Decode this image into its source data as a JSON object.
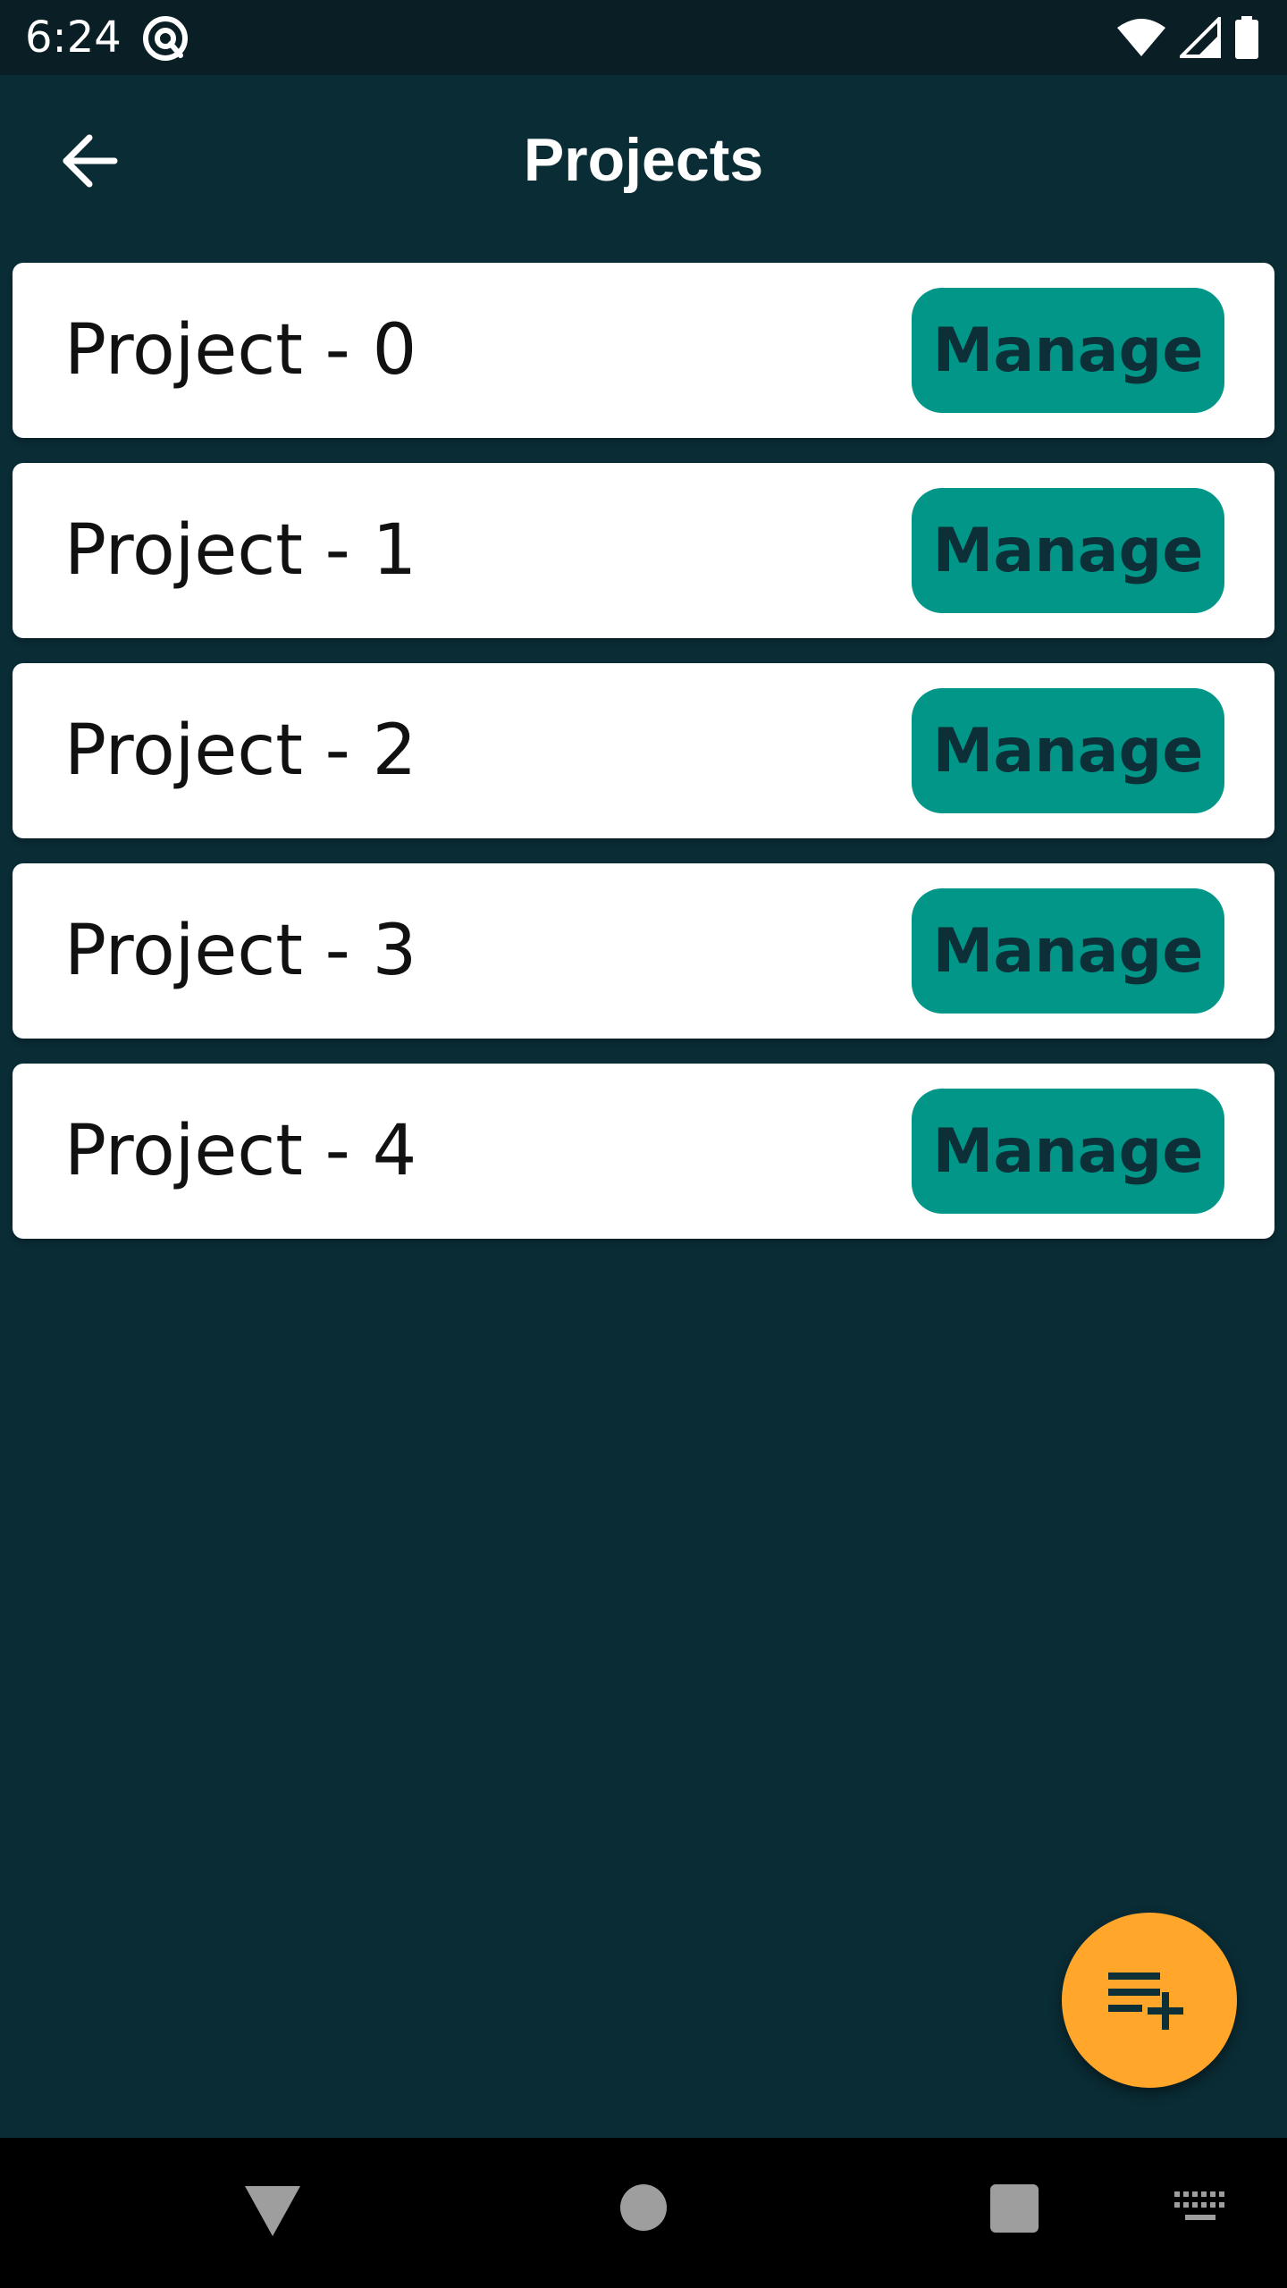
{
  "status_bar": {
    "time": "6:24",
    "icons": [
      "at-sign-app-icon",
      "wifi-icon",
      "cell-signal-icon",
      "battery-icon"
    ]
  },
  "app_bar": {
    "title": "Projects",
    "back_icon": "arrow-back-icon"
  },
  "projects": [
    {
      "name": "Project - 0",
      "button_label": "Manage"
    },
    {
      "name": "Project - 1",
      "button_label": "Manage"
    },
    {
      "name": "Project - 2",
      "button_label": "Manage"
    },
    {
      "name": "Project - 3",
      "button_label": "Manage"
    },
    {
      "name": "Project - 4",
      "button_label": "Manage"
    }
  ],
  "fab": {
    "icon": "playlist-add-icon"
  },
  "nav_bar": {
    "icons": [
      "nav-back-icon",
      "nav-home-icon",
      "nav-recents-icon",
      "keyboard-icon"
    ]
  },
  "colors": {
    "background": "#0a2c35",
    "status_bar": "#0a1f25",
    "card": "#ffffff",
    "button": "#029688",
    "button_text": "#0c2f38",
    "fab": "#ffa62b"
  }
}
